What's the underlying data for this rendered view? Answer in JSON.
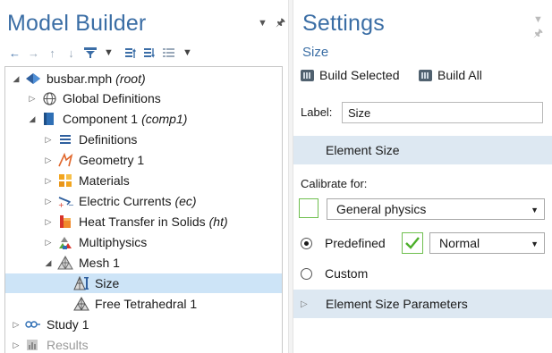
{
  "model_builder": {
    "title": "Model Builder",
    "toolbar_icons": [
      "arrow-left-icon",
      "arrow-right-icon",
      "arrow-up-icon",
      "arrow-down-icon",
      "filter-icon",
      "dropdown-arrow-icon",
      "sort-up-icon",
      "sort-down-icon",
      "list-options-icon",
      "dropdown-arrow-icon"
    ],
    "tree": [
      {
        "label": "busbar.mph",
        "tag": "(root)",
        "icon": "model-file-icon",
        "expander": "open"
      },
      {
        "label": "Global Definitions",
        "tag": "",
        "icon": "globe-icon",
        "expander": "closed"
      },
      {
        "label": "Component 1",
        "tag": "(comp1)",
        "icon": "component-icon",
        "expander": "open"
      },
      {
        "label": "Definitions",
        "tag": "",
        "icon": "definitions-icon",
        "expander": "closed"
      },
      {
        "label": "Geometry 1",
        "tag": "",
        "icon": "geometry-icon",
        "expander": "closed"
      },
      {
        "label": "Materials",
        "tag": "",
        "icon": "materials-icon",
        "expander": "closed"
      },
      {
        "label": "Electric Currents",
        "tag": "(ec)",
        "icon": "electric-currents-icon",
        "expander": "closed"
      },
      {
        "label": "Heat Transfer in Solids",
        "tag": "(ht)",
        "icon": "heat-transfer-icon",
        "expander": "closed"
      },
      {
        "label": "Multiphysics",
        "tag": "",
        "icon": "multiphysics-icon",
        "expander": "closed"
      },
      {
        "label": "Mesh 1",
        "tag": "",
        "icon": "mesh-icon",
        "expander": "open"
      },
      {
        "label": "Size",
        "tag": "",
        "icon": "mesh-size-icon",
        "expander": "none",
        "selected": true
      },
      {
        "label": "Free Tetrahedral 1",
        "tag": "",
        "icon": "free-tetrahedral-icon",
        "expander": "none"
      },
      {
        "label": "Study 1",
        "tag": "",
        "icon": "study-icon",
        "expander": "closed"
      },
      {
        "label": "Results",
        "tag": "",
        "icon": "results-icon",
        "expander": "closed"
      }
    ]
  },
  "settings": {
    "title": "Settings",
    "subtitle": "Size",
    "build_selected": "Build Selected",
    "build_all": "Build All",
    "label_caption": "Label:",
    "label_value": "Size",
    "element_size_header": "Element Size",
    "calibrate_for_label": "Calibrate for:",
    "calibrate_for_value": "General physics",
    "predefined_label": "Predefined",
    "predefined_value": "Normal",
    "custom_label": "Custom",
    "element_size_parameters_header": "Element Size Parameters",
    "predefined_selected": true
  },
  "colors": {
    "title_blue": "#3b6ea5",
    "selection": "#cde4f7",
    "section_bg": "#dde8f2",
    "check_green": "#4caf2a"
  }
}
